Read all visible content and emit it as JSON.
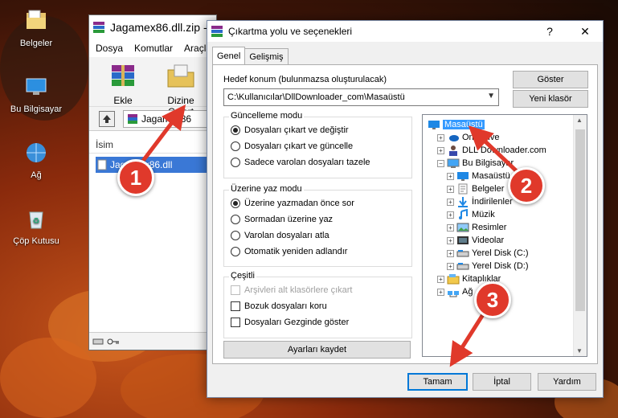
{
  "desktop": {
    "icons": [
      {
        "label": "Belgeler",
        "icon": "folder-documents-icon"
      },
      {
        "label": "Bu Bilgisayar",
        "icon": "computer-icon"
      },
      {
        "label": "Ağ",
        "icon": "network-icon"
      },
      {
        "label": "Çöp Kutusu",
        "icon": "recycle-bin-icon"
      }
    ]
  },
  "winrar": {
    "title": "Jagamex86.dll.zip -",
    "menu": [
      "Dosya",
      "Komutlar",
      "Araçla"
    ],
    "toolbar": {
      "add_label": "Ekle",
      "extract_label": "Dizine Çıkart"
    },
    "path": "Jagamex86",
    "column_name": "İsim",
    "file": "Jagamex86.dll"
  },
  "dialog": {
    "title": "Çıkartma yolu ve seçenekleri",
    "help": "?",
    "close": "✕",
    "tabs": [
      "Genel",
      "Gelişmiş"
    ],
    "dest_label": "Hedef konum (bulunmazsa oluşturulacak)",
    "dest_value": "C:\\Kullanıcılar\\DllDownloader_com\\Masaüstü",
    "show_button": "Göster",
    "new_folder_button": "Yeni klasör",
    "update_group": {
      "title": "Güncelleme modu",
      "options": [
        "Dosyaları çıkart ve değiştir",
        "Dosyaları çıkart ve güncelle",
        "Sadece varolan dosyaları tazele"
      ],
      "selected": 0
    },
    "overwrite_group": {
      "title": "Üzerine yaz modu",
      "options": [
        "Üzerine yazmadan önce sor",
        "Sormadan üzerine yaz",
        "Varolan dosyaları atla",
        "Otomatik yeniden adlandır"
      ],
      "selected": 0
    },
    "misc_group": {
      "title": "Çeşitli",
      "options": [
        {
          "label": "Arşivleri alt klasörlere çıkart",
          "checked": false,
          "disabled": true
        },
        {
          "label": "Bozuk dosyaları koru",
          "checked": false,
          "disabled": false
        },
        {
          "label": "Dosyaları Gezginde göster",
          "checked": false,
          "disabled": false
        }
      ]
    },
    "save_settings_button": "Ayarları kaydet",
    "tree": [
      {
        "label": "Masaüstü",
        "level": 0,
        "expander": "",
        "icon": "desktop-icon",
        "selected": true
      },
      {
        "label": "OneDrive",
        "level": 1,
        "expander": "+",
        "icon": "onedrive-icon"
      },
      {
        "label": "DLL Downloader.com",
        "level": 1,
        "expander": "+",
        "icon": "user-icon"
      },
      {
        "label": "Bu Bilgisayar",
        "level": 1,
        "expander": "−",
        "icon": "computer-icon"
      },
      {
        "label": "Masaüstü",
        "level": 2,
        "expander": "+",
        "icon": "desktop-icon"
      },
      {
        "label": "Belgeler",
        "level": 2,
        "expander": "+",
        "icon": "documents-icon"
      },
      {
        "label": "İndirilenler",
        "level": 2,
        "expander": "+",
        "icon": "download-icon"
      },
      {
        "label": "Müzik",
        "level": 2,
        "expander": "+",
        "icon": "music-icon"
      },
      {
        "label": "Resimler",
        "level": 2,
        "expander": "+",
        "icon": "pictures-icon"
      },
      {
        "label": "Videolar",
        "level": 2,
        "expander": "+",
        "icon": "videos-icon"
      },
      {
        "label": "Yerel Disk (C:)",
        "level": 2,
        "expander": "+",
        "icon": "disk-icon"
      },
      {
        "label": "Yerel Disk (D:)",
        "level": 2,
        "expander": "+",
        "icon": "disk-icon"
      },
      {
        "label": "Kitaplıklar",
        "level": 1,
        "expander": "+",
        "icon": "libraries-icon"
      },
      {
        "label": "Ağ",
        "level": 1,
        "expander": "+",
        "icon": "network-icon"
      }
    ],
    "ok_button": "Tamam",
    "cancel_button": "İptal",
    "help_button": "Yardım"
  },
  "callouts": [
    "1",
    "2",
    "3"
  ],
  "colors": {
    "callout": "#e0392b",
    "selection": "#3399ff",
    "accent": "#0078d7"
  }
}
